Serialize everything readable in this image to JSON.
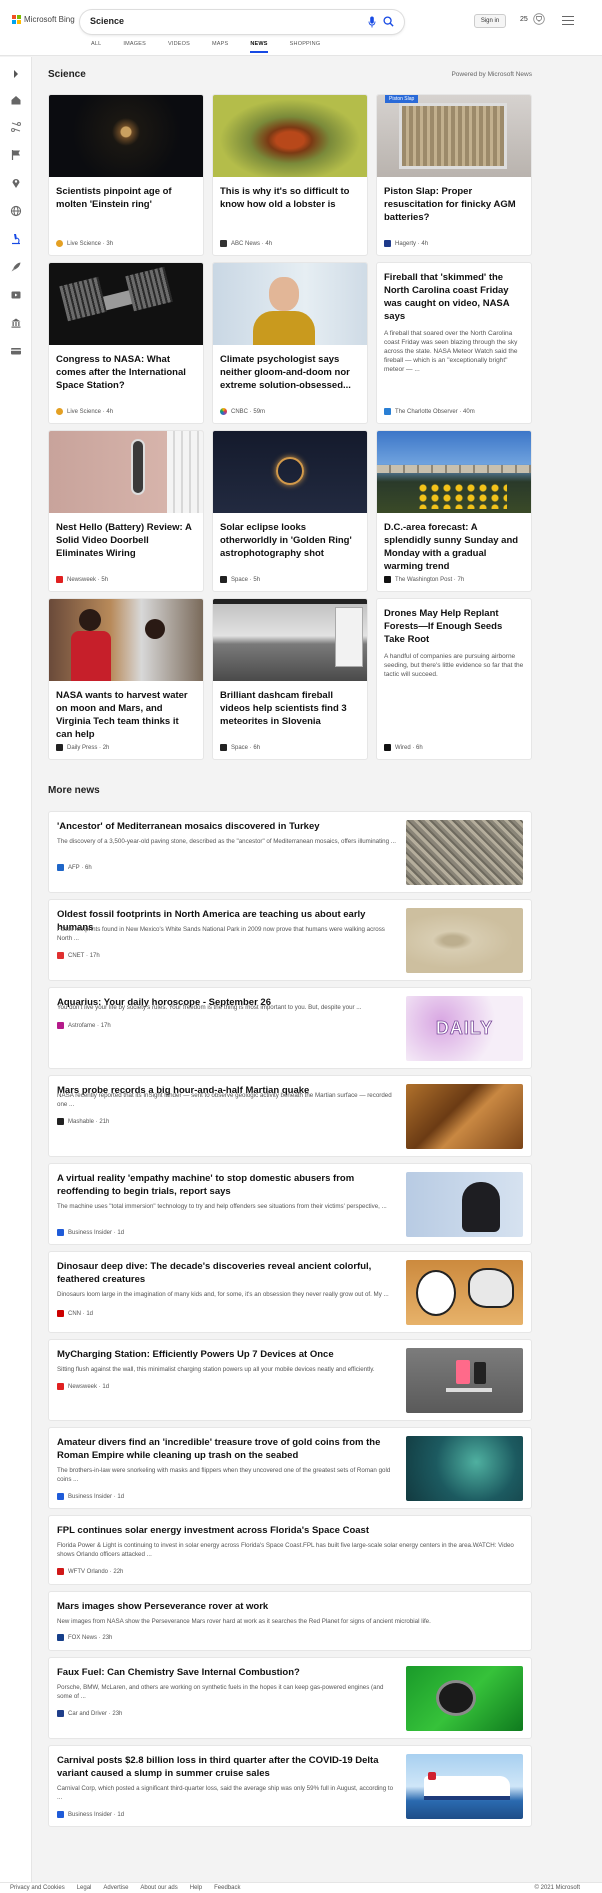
{
  "header": {
    "logo_text": "Microsoft Bing",
    "query": "Science",
    "signin": "Sign in",
    "points": "25",
    "tabs": [
      "ALL",
      "IMAGES",
      "VIDEOS",
      "MAPS",
      "NEWS",
      "SHOPPING"
    ],
    "active_tab": "NEWS"
  },
  "sidebar": {
    "icons": [
      "chevron-right-icon",
      "home-icon",
      "scissors-icon",
      "flag-icon",
      "location-icon",
      "globe-icon",
      "microscope-icon",
      "rocket-icon",
      "media-icon",
      "bank-icon",
      "card-icon"
    ]
  },
  "main": {
    "section_title": "Science",
    "powered_by": "Powered by Microsoft News",
    "cards": [
      {
        "title": "Scientists pinpoint age of molten 'Einstein ring'",
        "source": "Live Science",
        "time": "3h",
        "desc": ""
      },
      {
        "title": "This is why it's so difficult to know how old a lobster is",
        "source": "ABC News",
        "time": "4h",
        "desc": ""
      },
      {
        "title": "Piston Slap: Proper resuscitation for finicky AGM batteries?",
        "source": "Hagerty",
        "time": "4h",
        "desc": "",
        "img_label": "Piston Slap"
      },
      {
        "title": "Congress to NASA: What comes after the International Space Station?",
        "source": "Live Science",
        "time": "4h",
        "desc": ""
      },
      {
        "title": "Climate psychologist says neither gloom-and-doom nor extreme solution-obsessed...",
        "source": "CNBC",
        "time": "59m",
        "desc": ""
      },
      {
        "title": "Fireball that 'skimmed' the North Carolina coast Friday was caught on video, NASA says",
        "source": "The Charlotte Observer",
        "time": "40m",
        "desc": "A fireball that soared over the North Carolina coast Friday was seen blazing through the sky across the state. NASA Meteor Watch said the fireball — which is an \"exceptionally bright\" meteor — ..."
      },
      {
        "title": "Nest Hello (Battery) Review: A Solid Video Doorbell Eliminates Wiring",
        "source": "Newsweek",
        "time": "5h",
        "desc": ""
      },
      {
        "title": "Solar eclipse looks otherworldly in 'Golden Ring' astrophotography shot",
        "source": "Space",
        "time": "5h",
        "desc": ""
      },
      {
        "title": "D.C.-area forecast: A splendidly sunny Sunday and Monday with a gradual warming trend",
        "source": "The Washington Post",
        "time": "7h",
        "desc": ""
      },
      {
        "title": "NASA wants to harvest water on moon and Mars, and Virginia Tech team thinks it can help",
        "source": "Daily Press",
        "time": "2h",
        "desc": ""
      },
      {
        "title": "Brilliant dashcam fireball videos help scientists find 3 meteorites in Slovenia",
        "source": "Space",
        "time": "6h",
        "desc": ""
      },
      {
        "title": "Drones May Help Replant Forests—If Enough Seeds Take Root",
        "source": "Wired",
        "time": "6h",
        "desc": "A handful of companies are pursuing airborne seeding, but there's little evidence so far that the tactic will succeed."
      }
    ],
    "more_title": "More news",
    "news": [
      {
        "title": "'Ancestor' of Mediterranean mosaics discovered in Turkey",
        "desc": "The discovery of a 3,500-year-old paving stone, described as the \"ancestor\" of Mediterranean mosaics, offers illuminating ...",
        "source": "AFP",
        "time": "6h"
      },
      {
        "title": "Oldest fossil footprints in North America are teaching us about early humans",
        "desc": "Fossil footprints found in New Mexico's White Sands National Park in 2009 now prove that humans were walking across North ...",
        "source": "CNET",
        "time": "17h"
      },
      {
        "title": "Aquarius: Your daily horoscope - September 26",
        "desc": "You don't live your life by society's rules. Your freedom is the thing is most important to you. But, despite your ...",
        "source": "Astrofame",
        "time": "17h",
        "thumb_text": "DAILY"
      },
      {
        "title": "Mars probe records a big hour-and-a-half Martian quake",
        "desc": "NASA recently reported that its InSight lander — sent to observe geologic activity beneath the Martian surface — recorded one ...",
        "source": "Mashable",
        "time": "21h"
      },
      {
        "title": "A virtual reality 'empathy machine' to stop domestic abusers from reoffending to begin trials, report says",
        "desc": "The machine uses \"total immersion\" technology to try and help offenders see situations from their victims' perspective, ...",
        "source": "Business Insider",
        "time": "1d"
      },
      {
        "title": "Dinosaur deep dive: The decade's discoveries reveal ancient colorful, feathered creatures",
        "desc": "Dinosaurs loom large in the imagination of many kids and, for some, it's an obsession they never really grow out of. My ...",
        "source": "CNN",
        "time": "1d"
      },
      {
        "title": "MyCharging Station: Efficiently Powers Up 7 Devices at Once",
        "desc": "Sitting flush against the wall, this minimalist charging station powers up all your mobile devices neatly and efficiently.",
        "source": "Newsweek",
        "time": "1d"
      },
      {
        "title": "Amateur divers find an 'incredible' treasure trove of gold coins from the Roman Empire while cleaning up trash on the seabed",
        "desc": "The brothers-in-law were snorkeling with masks and flippers when they uncovered one of the greatest sets of Roman gold coins ...",
        "source": "Business Insider",
        "time": "1d"
      },
      {
        "title": "FPL continues solar energy investment across Florida's Space Coast",
        "desc": "Florida Power & Light is continuing to invest in solar energy across Florida's Space Coast.FPL has built five large-scale solar energy centers in the area.WATCH: Video shows Orlando officers attacked ...",
        "source": "WFTV Orlando",
        "time": "22h"
      },
      {
        "title": "Mars images show Perseverance rover at work",
        "desc": "New images from NASA show the Perseverance Mars rover hard at work as it searches the Red Planet for signs of ancient microbial life.",
        "source": "FOX News",
        "time": "23h"
      },
      {
        "title": "Faux Fuel: Can Chemistry Save Internal Combustion?",
        "desc": "Porsche, BMW, McLaren, and others are working on synthetic fuels in the hopes it can keep gas-powered engines (and some of ...",
        "source": "Car and Driver",
        "time": "23h"
      },
      {
        "title": "Carnival posts $2.8 billion loss in third quarter after the COVID-19 Delta variant caused a slump in summer cruise sales",
        "desc": "Carnival Corp, which posted a significant third-quarter loss, said the average ship was only 59% full in August, according to ...",
        "source": "Business Insider",
        "time": "1d"
      }
    ]
  },
  "footer": {
    "links": [
      "Privacy and Cookies",
      "Legal",
      "Advertise",
      "About our ads",
      "Help",
      "Feedback"
    ],
    "copyright": "© 2021 Microsoft"
  }
}
